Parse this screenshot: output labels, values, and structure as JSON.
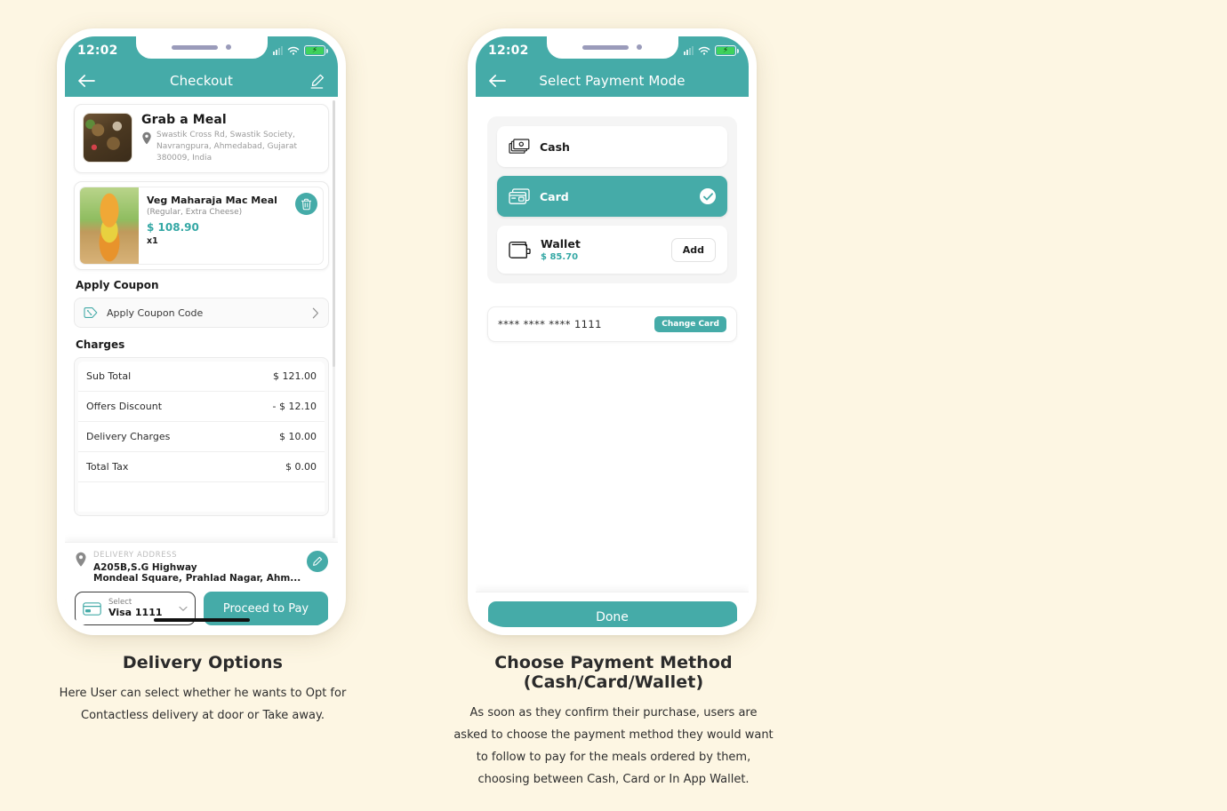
{
  "theme": {
    "accent": "#45ABA8",
    "page_bg": "#FDF6E3",
    "price_green": "#35A8A5",
    "battery_green": "#3FD25C"
  },
  "phone1": {
    "status": {
      "time": "12:02"
    },
    "header": {
      "title": "Checkout",
      "back_icon": "arrow-left-icon",
      "edit_icon": "pencil-edit-icon"
    },
    "restaurant": {
      "name": "Grab a Meal",
      "address": "Swastik Cross Rd, Swastik Society, Navrangpura, Ahmedabad, Gujarat 380009, India",
      "pin_icon": "location-pin-icon"
    },
    "meal": {
      "name": "Veg Maharaja Mac Meal",
      "options": "(Regular, Extra Cheese)",
      "price": "$ 108.90",
      "quantity": "x1",
      "delete_icon": "trash-icon"
    },
    "coupon": {
      "section_title": "Apply Coupon",
      "label": "Apply Coupon Code",
      "tag_icon": "coupon-tag-icon",
      "chevron_icon": "chevron-right-icon"
    },
    "charges": {
      "section_title": "Charges",
      "rows": [
        {
          "label": "Sub Total",
          "value": "$ 121.00"
        },
        {
          "label": "Offers Discount",
          "value": "- $ 12.10"
        },
        {
          "label": "Delivery Charges",
          "value": "$ 10.00"
        },
        {
          "label": "Total Tax",
          "value": "$ 0.00"
        }
      ]
    },
    "delivery": {
      "label": "DELIVERY ADDRESS",
      "line1": "A205B,S.G Highway",
      "line2": "Mondeal Square, Prahlad Nagar, Ahm...",
      "pin_icon": "location-pin-icon",
      "edit_icon": "pencil-edit-icon"
    },
    "pay_bar": {
      "select_small": "Select",
      "select_value": "Visa 1111",
      "card_icon": "credit-card-icon",
      "chevron_icon": "chevron-down-icon",
      "proceed_label": "Proceed to Pay"
    }
  },
  "phone2": {
    "status": {
      "time": "12:02"
    },
    "header": {
      "title": "Select Payment Mode",
      "back_icon": "arrow-left-icon"
    },
    "payment_options": [
      {
        "name": "Cash",
        "icon": "cash-notes-icon",
        "selected": false,
        "sub": "",
        "action": ""
      },
      {
        "name": "Card",
        "icon": "credit-card-icon",
        "selected": true,
        "sub": "",
        "action": ""
      },
      {
        "name": "Wallet",
        "icon": "wallet-icon",
        "selected": false,
        "sub": "$ 85.70",
        "action": "Add"
      }
    ],
    "saved_card": {
      "number": "**** **** **** 1111",
      "change_label": "Change Card"
    },
    "done_label": "Done"
  },
  "captions": [
    {
      "title": "Delivery Options",
      "lines": [
        "Here User can select whether he wants to Opt for",
        "Contactless delivery at door or Take away."
      ]
    },
    {
      "title": "Choose Payment Method (Cash/Card/Wallet)",
      "lines": [
        "As soon as they confirm their purchase, users are",
        "asked to choose the payment method they would want",
        "to follow to pay for the meals ordered by them,",
        "choosing between Cash, Card or In App Wallet."
      ]
    }
  ]
}
